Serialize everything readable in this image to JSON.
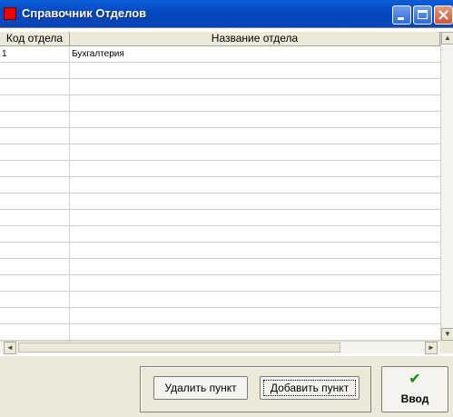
{
  "window": {
    "title": "Справочник Отделов",
    "controls": [
      "minimize",
      "maximize",
      "close"
    ]
  },
  "table": {
    "columns": [
      "Код отдела",
      "Название отдела"
    ],
    "rows": [
      [
        "1",
        "Бухгалтерия"
      ],
      [
        "",
        ""
      ],
      [
        "",
        ""
      ],
      [
        "",
        ""
      ],
      [
        "",
        ""
      ],
      [
        "",
        ""
      ],
      [
        "",
        ""
      ],
      [
        "",
        ""
      ],
      [
        "",
        ""
      ],
      [
        "",
        ""
      ],
      [
        "",
        ""
      ],
      [
        "",
        ""
      ],
      [
        "",
        ""
      ],
      [
        "",
        ""
      ],
      [
        "",
        ""
      ],
      [
        "",
        ""
      ],
      [
        "",
        ""
      ],
      [
        "",
        ""
      ]
    ]
  },
  "buttons": {
    "delete_label": "Удалить пункт",
    "add_label": "Добавить пункт",
    "enter_label": "Ввод",
    "enter_icon": "checkmark-icon"
  },
  "colors": {
    "titlebar": "#0a5fd8",
    "face": "#ece9d8",
    "check": "#0a8a1a"
  }
}
